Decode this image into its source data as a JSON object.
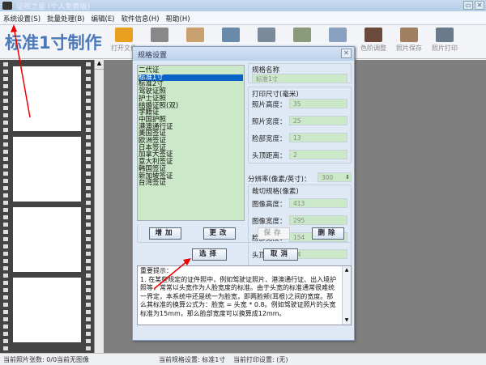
{
  "window": {
    "title": "证照之星 (个人免费版)",
    "min": "▭",
    "close": "✕"
  },
  "menu": [
    "系统设置(S)",
    "批量处理(B)",
    "编辑(E)",
    "软件信息(H)",
    "帮助(H)"
  ],
  "brand": "标准1寸制作",
  "toolbar": [
    {
      "label": "打开文件",
      "icon": "folder-icon",
      "color": "#e8a020"
    },
    {
      "label": "",
      "icon": "camera-icon",
      "color": "#888"
    },
    {
      "label": "",
      "icon": "hand-icon",
      "color": "#c9a070"
    },
    {
      "label": "",
      "icon": "rotate-icon",
      "color": "#6a8aaa"
    },
    {
      "label": "",
      "icon": "crop-icon",
      "color": "#7a8a9a"
    },
    {
      "label": "",
      "icon": "layout-icon",
      "color": "#8a9a7a"
    },
    {
      "label": "",
      "icon": "brush-icon",
      "color": "#8aa0c0"
    },
    {
      "label": "色阶调整",
      "icon": "levels-icon",
      "color": "#6a4a3a"
    },
    {
      "label": "照片保存",
      "icon": "save-icon",
      "color": "#a08060"
    },
    {
      "label": "照片打印",
      "icon": "printer-icon",
      "color": "#6a7a8a"
    }
  ],
  "dialog": {
    "title": "规格设置",
    "list": [
      "二代证",
      "标准1寸",
      "标准2寸",
      "驾驶证照",
      "护士证照",
      "结婚证照(双)",
      "学籍证",
      "中国护照",
      "港澳通行证",
      "美国签证",
      "欧洲签证",
      "日本签证",
      "加拿大签证",
      "意大利签证",
      "韩国签证",
      "新加坡签证",
      "台湾签证"
    ],
    "selected_index": 1,
    "spec_name_label": "规格名称",
    "spec_name": "标准1寸",
    "print_group": "打印尺寸(毫米)",
    "print_fields": [
      {
        "label": "照片高度：",
        "value": "35"
      },
      {
        "label": "照片宽度：",
        "value": "25"
      },
      {
        "label": "脸部宽度：",
        "value": "13"
      },
      {
        "label": "头顶距离：",
        "value": "2"
      }
    ],
    "dpi_label": "分辨率(像素/英寸)：",
    "dpi": "300",
    "crop_group": "裁切规格(像素)",
    "crop_fields": [
      {
        "label": "图像高度：",
        "value": "413"
      },
      {
        "label": "图像宽度：",
        "value": "295"
      },
      {
        "label": "脸部宽度：",
        "value": "154"
      },
      {
        "label": "头顶距离：",
        "value": "24"
      }
    ],
    "buttons": {
      "add": "增加",
      "edit": "更改",
      "save": "保存",
      "delete": "删除",
      "select": "选择",
      "cancel": "取消"
    },
    "tips": "重要提示：\n1. 在某些规定的证件照中，例如驾驶证照片、港澳通行证、出入境护照等，常常以头宽作为人脸宽度的标准。由于头宽的标准通常很难统一界定，本系统中还是统一为脸宽，即两脸颊(耳根)之间的宽度。那么其标准的换算公式为：脸宽 = 头宽 * 0.8。例如驾驶证照片的头宽标准为15mm，那么脸部宽度可以换算成12mm。"
  },
  "status": {
    "count": "当前照片张数: 0/0",
    "image": "当前无图像",
    "spec": "当前规格设置: 标准1寸",
    "print": "当前打印设置: (无)"
  }
}
